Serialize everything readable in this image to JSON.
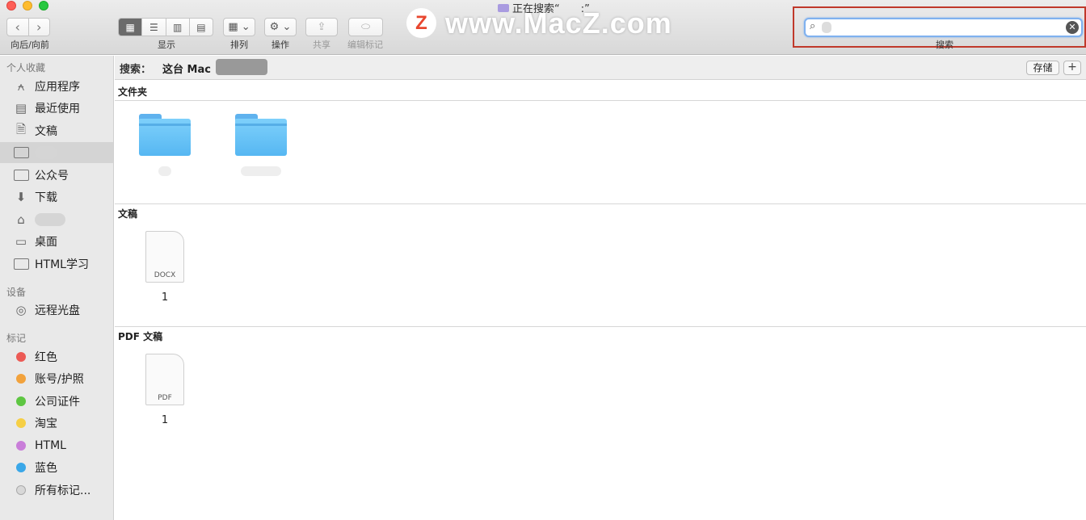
{
  "window": {
    "title": "正在搜索“　　:”"
  },
  "toolbar": {
    "nav_back": "‹",
    "nav_forward": "›",
    "nav_label": "向后/向前",
    "view_label": "显示",
    "sort_label": "排列",
    "action_label": "操作",
    "share_label": "共享",
    "tags_label": "编辑标记",
    "search_label": "搜索"
  },
  "watermark": {
    "logo": "Z",
    "text": "www.MacZ.com"
  },
  "search": {
    "value": ""
  },
  "sidebar": {
    "favorites_title": "个人收藏",
    "favorites": [
      {
        "label": "应用程序",
        "icon": "applications-icon"
      },
      {
        "label": "最近使用",
        "icon": "recents-icon"
      },
      {
        "label": "文稿",
        "icon": "documents-icon"
      },
      {
        "label": "",
        "icon": "folder-icon"
      },
      {
        "label": "公众号",
        "icon": "folder-icon"
      },
      {
        "label": "下载",
        "icon": "downloads-icon"
      },
      {
        "label": "",
        "icon": "home-icon"
      },
      {
        "label": "桌面",
        "icon": "desktop-icon"
      },
      {
        "label": "HTML学习",
        "icon": "folder-icon"
      }
    ],
    "devices_title": "设备",
    "devices": [
      {
        "label": "远程光盘",
        "icon": "disc-icon"
      }
    ],
    "tags_title": "标记",
    "tags": [
      {
        "label": "红色",
        "color": "#ec5a55"
      },
      {
        "label": "账号/护照",
        "color": "#f2a23c"
      },
      {
        "label": "公司证件",
        "color": "#5ec642"
      },
      {
        "label": "淘宝",
        "color": "#f6cf45"
      },
      {
        "label": "HTML",
        "color": "#c97ed9"
      },
      {
        "label": "蓝色",
        "color": "#3aa7e8"
      },
      {
        "label": "所有标记...",
        "color": "#d8d8d8"
      }
    ]
  },
  "scope": {
    "label": "搜索：",
    "this_mac": "这台 Mac",
    "save": "存储",
    "add": "+"
  },
  "groups": {
    "folders_title": "文件夹",
    "documents_title": "文稿",
    "documents": [
      {
        "name": "1",
        "type": "DOCX"
      }
    ],
    "pdf_title": "PDF 文稿",
    "pdfs": [
      {
        "name": "1",
        "type": "PDF"
      }
    ]
  }
}
